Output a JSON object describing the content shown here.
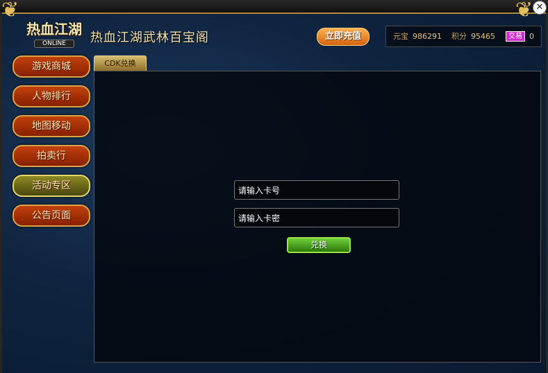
{
  "window": {
    "title": "热血江湖武林百宝阁",
    "close_label": "✕"
  },
  "logo": {
    "main_text": "热血江湖",
    "sub_text": "ONLINE"
  },
  "header": {
    "recharge_label": "立即充值",
    "currency": {
      "yuanbao_label": "元宝",
      "yuanbao_value": "986291",
      "points_label": "积分",
      "points_value": "95465",
      "trade_label": "交易",
      "trade_value": "0"
    }
  },
  "sidebar": {
    "items": [
      {
        "label": "游戏商城",
        "active": false
      },
      {
        "label": "人物排行",
        "active": false
      },
      {
        "label": "地图移动",
        "active": false
      },
      {
        "label": "拍卖行",
        "active": false
      },
      {
        "label": "活动专区",
        "active": true
      },
      {
        "label": "公告页面",
        "active": false
      }
    ]
  },
  "tabs": [
    {
      "label": "CDK兑换"
    }
  ],
  "form": {
    "card_number_placeholder": "请输入卡号",
    "card_password_placeholder": "请输入卡密",
    "submit_label": "兑换"
  },
  "colors": {
    "background": "#0f2440",
    "panel": "#03080f",
    "gold": "#d8a648",
    "sidebar_button": "#a7300a",
    "active_button": "#7a7620",
    "redeem_button": "#4aa620",
    "trade_badge": "#d12ad1"
  }
}
